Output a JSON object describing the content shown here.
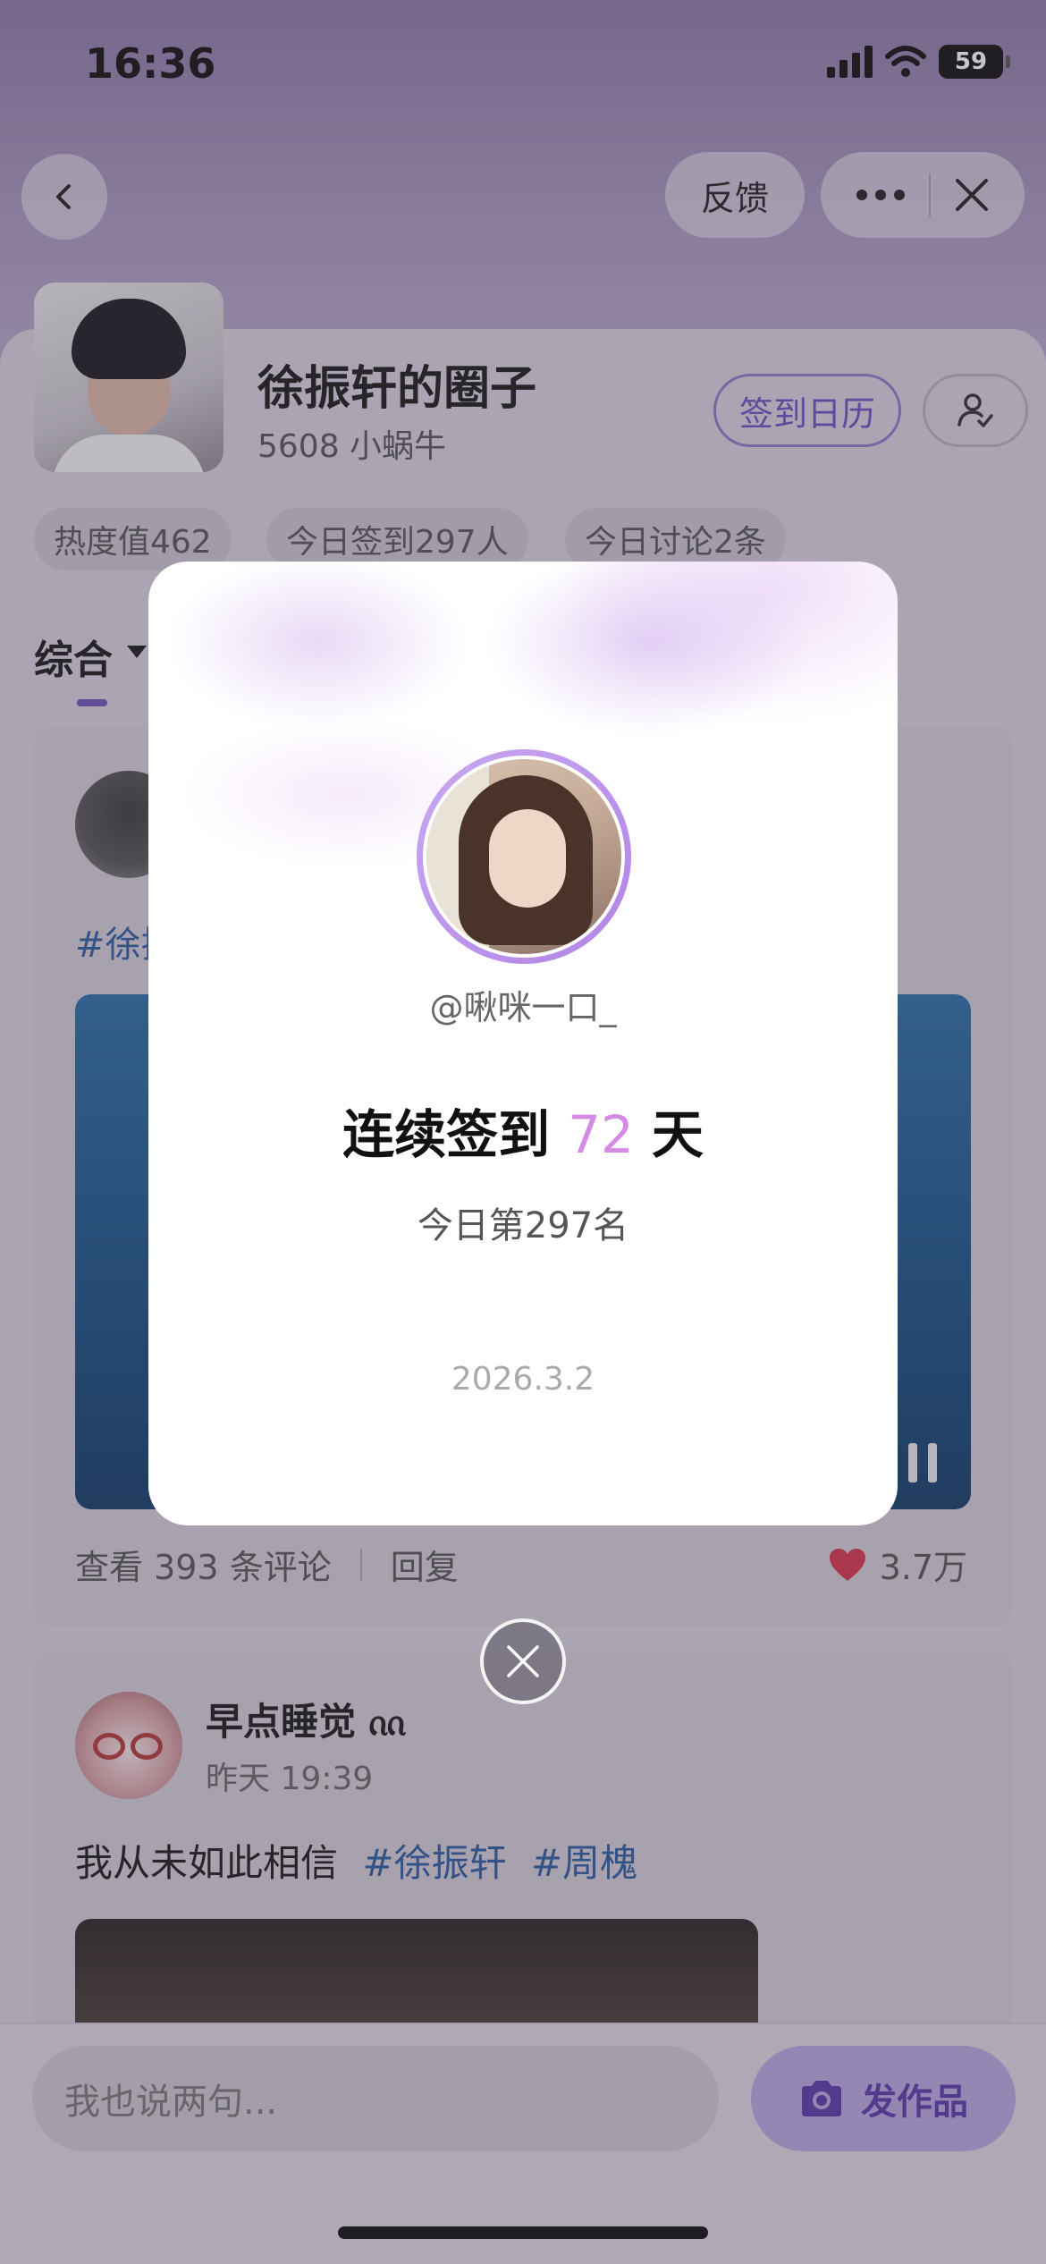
{
  "status_bar": {
    "time": "16:36",
    "battery": "59"
  },
  "nav": {
    "feedback_label": "反馈"
  },
  "circle": {
    "title": "徐振轩的圈子",
    "members": "5608 小蜗牛",
    "calendar_label": "签到日历",
    "stats": [
      "热度值462",
      "今日签到297人",
      "今日讨论2条"
    ],
    "tab": "综合"
  },
  "post1": {
    "hashtag": "#徐振",
    "comments_label": "查看 393 条评论",
    "reply_label": "回复",
    "likes": "3.7万"
  },
  "post2": {
    "author": "早点睡觉 ᦶ",
    "time": "昨天 19:39",
    "text": "我从未如此相信",
    "tags": [
      "#徐振轩",
      "#周槐"
    ]
  },
  "bottom": {
    "input_placeholder": "我也说两句...",
    "publish_label": "发作品"
  },
  "modal": {
    "handle": "@啾咪一口_",
    "streak_prefix": "连续签到",
    "streak_days": "72",
    "streak_suffix": "天",
    "rank": "今日第297名",
    "date": "2026.3.2"
  },
  "colors": {
    "accent_purple": "#6e4fbd",
    "streak_pink": "#d58be3",
    "hashtag_blue": "#2f5c9e",
    "like_red": "#d6354a"
  }
}
